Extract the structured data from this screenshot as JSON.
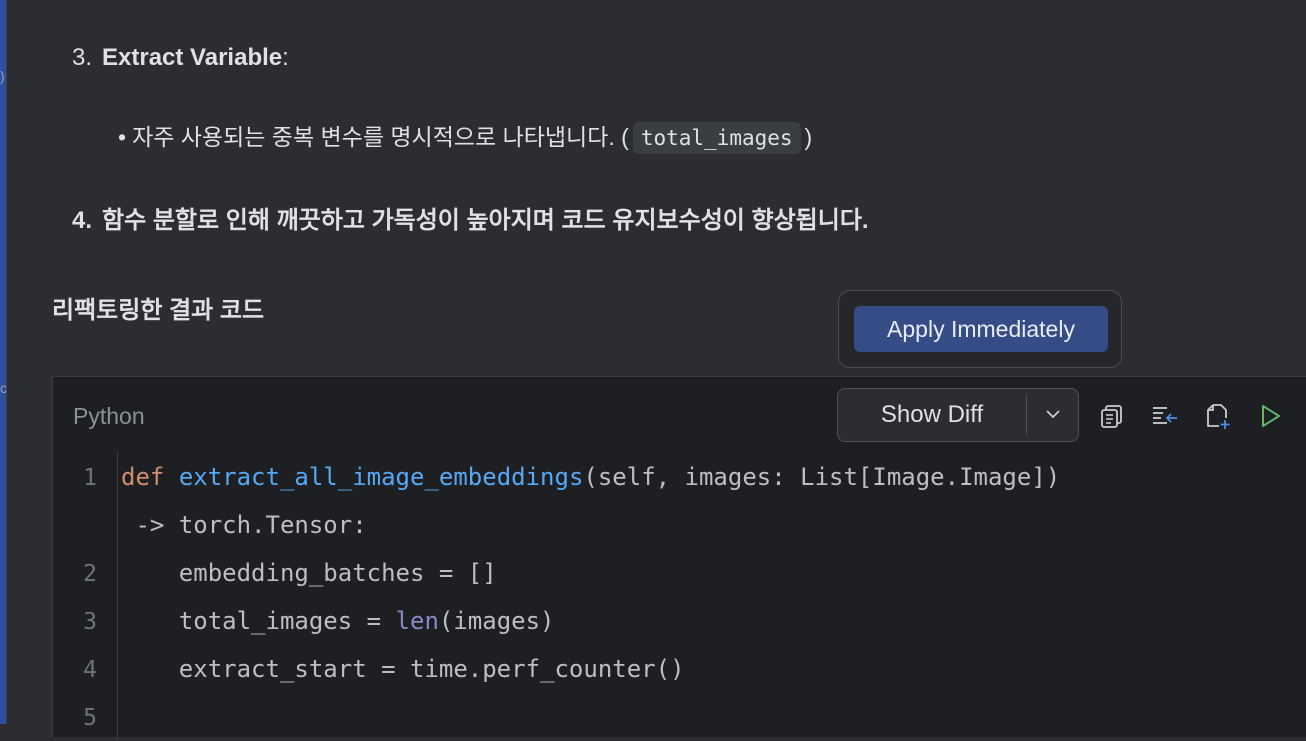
{
  "list": {
    "item3": {
      "number": "3.",
      "title": "Extract Variable",
      "suffix": ":"
    },
    "bullet": {
      "symbol": "•",
      "text": "자주 사용되는 중복 변수를 명시적으로 나타냅니다.",
      "open": "(",
      "code": "total_images",
      "close": ")"
    },
    "item4": {
      "number": "4.",
      "text": "함수 분할로 인해 깨끗하고 가독성이 높아지며 코드 유지보수성이 향상됩니다."
    }
  },
  "section_title": "리팩토링한 결과 코드",
  "popup": {
    "apply_label": "Apply Immediately"
  },
  "code_block": {
    "language": "Python",
    "show_diff_label": "Show Diff",
    "toolbar_icons": [
      "copy-icon",
      "insert-at-caret-icon",
      "new-file-icon",
      "run-icon"
    ],
    "line_numbers": [
      "1",
      "2",
      "3",
      "4",
      "5"
    ],
    "lines": {
      "l1_kw": "def",
      "l1_fn": "extract_all_image_embeddings",
      "l1_rest": "(self, images: List[Image.Image])",
      "l1_wrap": " -> torch.Tensor:",
      "l2": "    embedding_batches = []",
      "l3_a": "    total_images = ",
      "l3_bi": "len",
      "l3_b": "(images)",
      "l4": "    extract_start = time.perf_counter()"
    }
  },
  "colors": {
    "accent": "#354c86",
    "keyword": "#cf8e6d",
    "function": "#56a8f5",
    "builtin": "#8888c6",
    "run": "#5fb865"
  }
}
